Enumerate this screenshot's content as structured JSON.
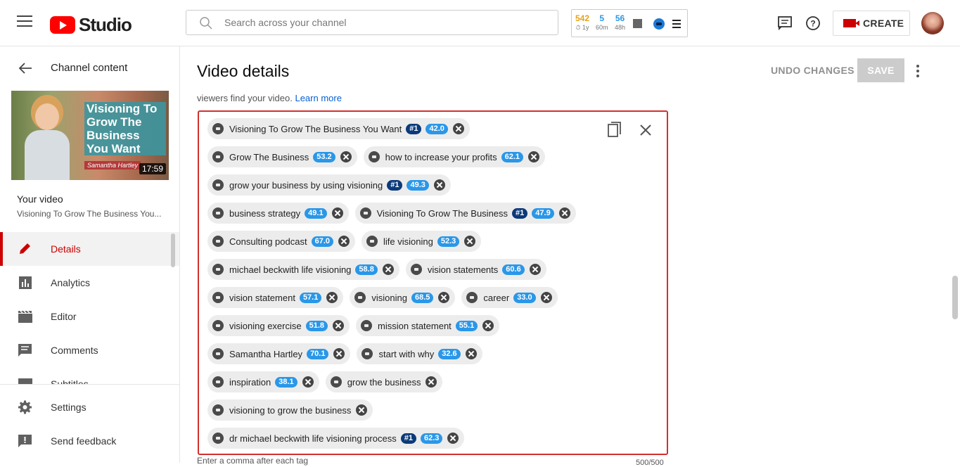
{
  "header": {
    "logo_text": "Studio",
    "search_placeholder": "Search across your channel",
    "stats": [
      {
        "value": "542",
        "sub": "⏱ 1y",
        "color": "#e8a317"
      },
      {
        "value": "5",
        "sub": "60m",
        "color": "#2a97e8"
      },
      {
        "value": "56",
        "sub": "48h",
        "color": "#2a97e8"
      }
    ],
    "create_label": "CREATE"
  },
  "sidebar": {
    "channel_label": "Channel content",
    "thumbnail_title": "Visioning To Grow The Business You Want",
    "thumbnail_name": "Samantha Hartley",
    "thumbnail_duration": "17:59",
    "your_video_label": "Your video",
    "video_title": "Visioning To Grow The Business You...",
    "items": [
      {
        "label": "Details",
        "icon": "pencil-icon",
        "active": true
      },
      {
        "label": "Analytics",
        "icon": "analytics-icon",
        "active": false
      },
      {
        "label": "Editor",
        "icon": "clapperboard-icon",
        "active": false
      },
      {
        "label": "Comments",
        "icon": "comment-icon",
        "active": false
      },
      {
        "label": "Subtitles",
        "icon": "subtitles-icon",
        "active": false
      }
    ],
    "bottom_items": [
      {
        "label": "Settings",
        "icon": "gear-icon"
      },
      {
        "label": "Send feedback",
        "icon": "feedback-icon"
      }
    ]
  },
  "main": {
    "title": "Video details",
    "undo_label": "UNDO CHANGES",
    "save_label": "SAVE",
    "hint_text": "viewers find your video.",
    "hint_link": "Learn more",
    "footer_hint": "Enter a comma after each tag",
    "char_count": "500/500",
    "tags": [
      [
        {
          "text": "Visioning To Grow The Business You Want",
          "rank": "#1",
          "score": "42.0"
        }
      ],
      [
        {
          "text": "Grow The Business",
          "rank": "",
          "score": "53.2"
        },
        {
          "text": "how to increase your profits",
          "rank": "",
          "score": "62.1"
        }
      ],
      [
        {
          "text": "grow your business by using visioning",
          "rank": "#1",
          "score": "49.3"
        }
      ],
      [
        {
          "text": "business strategy",
          "rank": "",
          "score": "49.1"
        },
        {
          "text": "Visioning To Grow The Business",
          "rank": "#1",
          "score": "47.9"
        }
      ],
      [
        {
          "text": "Consulting podcast",
          "rank": "",
          "score": "67.0"
        },
        {
          "text": "life visioning",
          "rank": "",
          "score": "52.3"
        }
      ],
      [
        {
          "text": "michael beckwith life visioning",
          "rank": "",
          "score": "58.8"
        },
        {
          "text": "vision statements",
          "rank": "",
          "score": "60.6"
        }
      ],
      [
        {
          "text": "vision statement",
          "rank": "",
          "score": "57.1"
        },
        {
          "text": "visioning",
          "rank": "",
          "score": "68.5"
        },
        {
          "text": "career",
          "rank": "",
          "score": "33.0"
        }
      ],
      [
        {
          "text": "visioning exercise",
          "rank": "",
          "score": "51.8"
        },
        {
          "text": "mission statement",
          "rank": "",
          "score": "55.1"
        }
      ],
      [
        {
          "text": "Samantha Hartley",
          "rank": "",
          "score": "70.1"
        },
        {
          "text": "start with why",
          "rank": "",
          "score": "32.6"
        }
      ],
      [
        {
          "text": "inspiration",
          "rank": "",
          "score": "38.1"
        },
        {
          "text": "grow the business",
          "rank": "",
          "score": ""
        }
      ],
      [
        {
          "text": "visioning to grow the business",
          "rank": "",
          "score": ""
        }
      ],
      [
        {
          "text": "dr michael beckwith life visioning process",
          "rank": "#1",
          "score": "62.3"
        }
      ]
    ]
  }
}
